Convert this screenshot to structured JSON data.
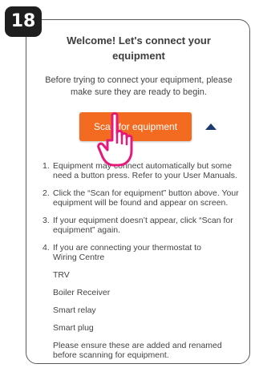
{
  "step_number": "18",
  "title": "Welcome! Let's connect your equipment",
  "intro": "Before trying to connect your equipment, please make sure they are ready to begin.",
  "scan_button_label": "Scan for equipment",
  "icons": {
    "collapse": "chevron-up-icon",
    "pointer": "hand-pointer-icon"
  },
  "colors": {
    "accent": "#f26b21",
    "pointer": "#e6197a",
    "chevron": "#1d3a6e"
  },
  "instructions": [
    {
      "num": "1.",
      "text": "Equipment may connect automatically but some need a button press. Refer to your User Manuals."
    },
    {
      "num": "2.",
      "text": "Click the “Scan for equipment” button above. Your equipment will be found and appear on screen."
    },
    {
      "num": "3.",
      "text": "If your equipment doesn’t appear, click “Scan for equipment” again."
    },
    {
      "num": "4.",
      "text": "If you are connecting your thermostat to",
      "devices": [
        "Wiring Centre",
        "TRV",
        "Boiler Receiver",
        "Smart relay",
        "Smart plug"
      ],
      "footer": "Please ensure these are added and renamed before scanning for equipment."
    }
  ]
}
